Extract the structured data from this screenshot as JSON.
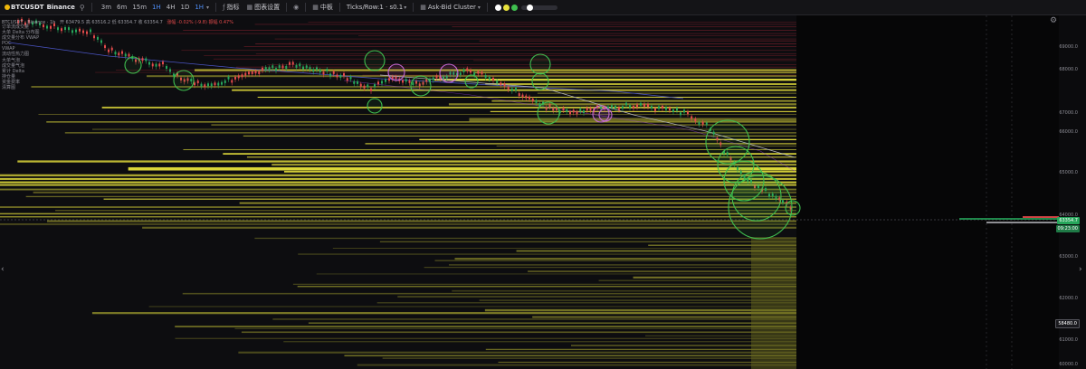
{
  "toolbar": {
    "symbol": "BTCUSDT",
    "exchange": "Binance",
    "search_icon": "search-icon",
    "timeframes": [
      "3m",
      "6m",
      "15m",
      "1H",
      "4H",
      "1D"
    ],
    "active_timeframe": "1H",
    "indicators_label": "指标",
    "chart_settings_label": "图表设置",
    "visibility_icon": "eye-icon",
    "tab_middle": "中板",
    "ticks_per_row": "Ticks/Row:1 · s0.1",
    "cluster_mode": "Ask-Bid Cluster",
    "color_dots": [
      "#ffffff",
      "#e8e23c",
      "#3fbf4f",
      "#4f8ef7"
    ]
  },
  "info_line": {
    "prefix": "BTCUSDT · Binance · 1h",
    "ohlc": "开 63479.5  高 63516.2  低 63354.7  收 63354.7",
    "change": "涨幅 -0.02% (-9.8)  振幅 0.47%"
  },
  "indicator_list": [
    "订单流成交量",
    "大单 Delta 分布图",
    "成交量分布 VWAP",
    "POC",
    "VWAP",
    "流动性热力图",
    "大单气泡",
    "成交量气泡",
    "累计 Delta",
    "持仓量",
    "资金费率",
    "清算图"
  ],
  "price_axis": {
    "ticks": [
      "69000.0",
      "68000.0",
      "67000.0",
      "66000.0",
      "65000.0",
      "64000.0",
      "63000.0",
      "62000.0",
      "61000.0",
      "60000.0"
    ],
    "current_price": "63354.7",
    "countdown": "09:23:00",
    "marked_price": "58480.0"
  },
  "colors": {
    "background": "#0b0b0d",
    "liquidity": "#e8e23c",
    "bubble_buy": "#3fbf4f",
    "bubble_sell": "#c46ad6",
    "price_up": "#26a65b",
    "price_down": "#e34b4b",
    "accent": "#4f8ef7"
  }
}
